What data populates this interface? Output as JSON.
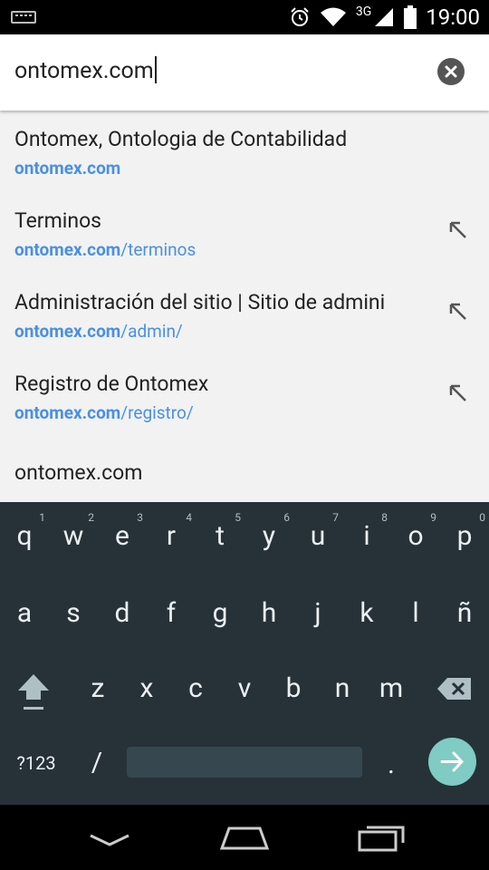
{
  "status_bar": {
    "network_label": "3G",
    "time": "19:00"
  },
  "url_bar": {
    "value": "ontomex.com"
  },
  "suggestions": [
    {
      "title": "Ontomex, Ontologia de Contabilidad",
      "domain": "ontomex.com",
      "path": "",
      "has_arrow": false
    },
    {
      "title": "Terminos",
      "domain": "ontomex.com",
      "path": "/terminos",
      "has_arrow": true
    },
    {
      "title": "Administración del sitio | Sitio de admini",
      "domain": "ontomex.com",
      "path": "/admin/",
      "has_arrow": true
    },
    {
      "title": "Registro de Ontomex",
      "domain": "ontomex.com",
      "path": "/registro/",
      "has_arrow": true
    },
    {
      "title": "ontomex.com",
      "domain": "",
      "path": "",
      "has_arrow": false
    }
  ],
  "keyboard": {
    "row1": [
      "q",
      "w",
      "e",
      "r",
      "t",
      "y",
      "u",
      "i",
      "o",
      "p"
    ],
    "row1_hints": [
      "1",
      "2",
      "3",
      "4",
      "5",
      "6",
      "7",
      "8",
      "9",
      "0"
    ],
    "row2": [
      "a",
      "s",
      "d",
      "f",
      "g",
      "h",
      "j",
      "k",
      "l",
      "ñ"
    ],
    "row3": [
      "z",
      "x",
      "c",
      "v",
      "b",
      "n",
      "m"
    ],
    "symbols_label": "?123",
    "slash": "/",
    "period": "."
  },
  "colors": {
    "accent_link": "#4a90e2",
    "keyboard_bg": "#263238",
    "enter_key": "#80cbc4"
  }
}
